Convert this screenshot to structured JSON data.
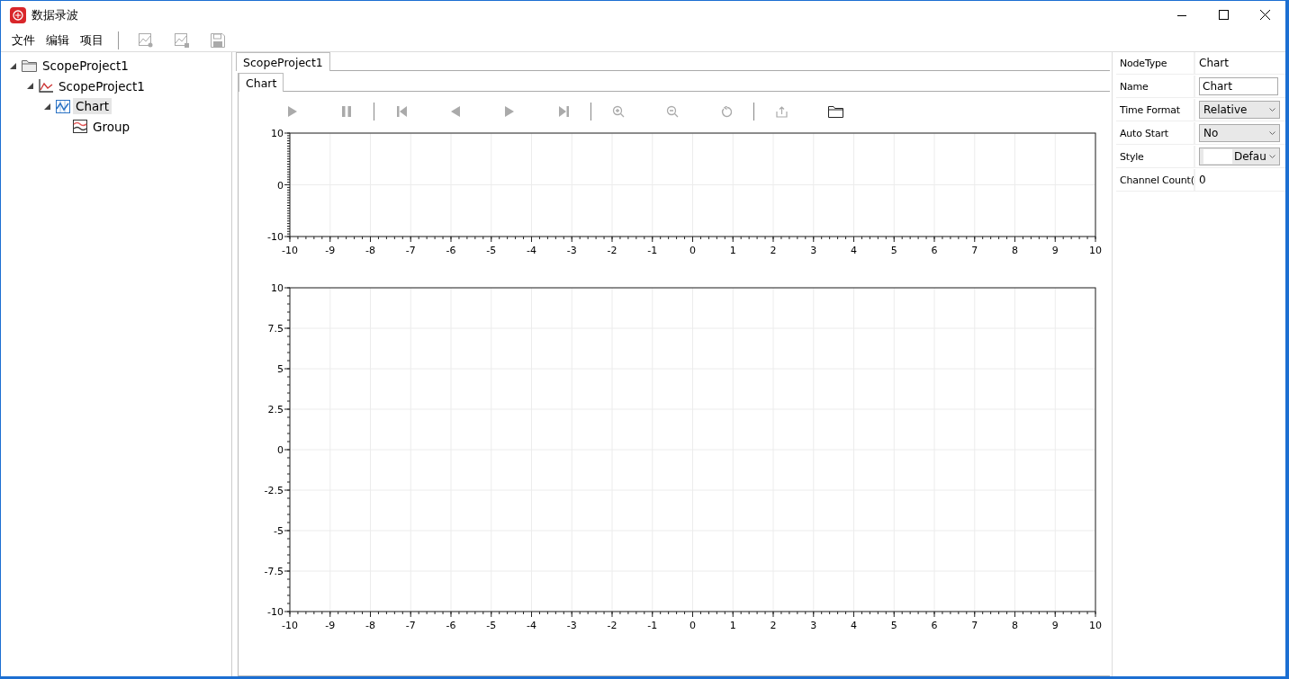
{
  "window": {
    "title": "数据录波"
  },
  "menu": [
    "文件",
    "编辑",
    "项目"
  ],
  "menu_toolbar": [
    {
      "kind": "add-chart",
      "disabled": true
    },
    {
      "kind": "add-group",
      "disabled": true
    },
    {
      "kind": "save",
      "disabled": true
    }
  ],
  "tree": [
    {
      "label": "ScopeProject1",
      "kind": "folder",
      "expanded": true,
      "selected": false,
      "children": [
        {
          "label": "ScopeProject1",
          "kind": "scope",
          "expanded": true,
          "selected": false,
          "children": [
            {
              "label": "Chart",
              "kind": "chart",
              "expanded": true,
              "selected": true,
              "children": [
                {
                  "label": "Group",
                  "kind": "group",
                  "selected": false
                }
              ]
            }
          ]
        }
      ]
    }
  ],
  "document_tabs": [
    {
      "label": "ScopeProject1",
      "selected": true
    }
  ],
  "chart_tabs": [
    {
      "label": "Chart",
      "selected": true
    }
  ],
  "chart_toolbar": [
    {
      "kind": "play",
      "disabled": true
    },
    {
      "kind": "pause",
      "disabled": true
    },
    {
      "kind": "separator"
    },
    {
      "kind": "first",
      "disabled": true
    },
    {
      "kind": "prev",
      "disabled": true
    },
    {
      "kind": "next",
      "disabled": true
    },
    {
      "kind": "last",
      "disabled": true
    },
    {
      "kind": "separator"
    },
    {
      "kind": "zoom-in",
      "disabled": true
    },
    {
      "kind": "zoom-out",
      "disabled": true
    },
    {
      "kind": "reset",
      "disabled": true
    },
    {
      "kind": "separator"
    },
    {
      "kind": "export",
      "disabled": true
    },
    {
      "kind": "open",
      "disabled": false
    }
  ],
  "charts": [
    {
      "chart_data": {
        "type": "line",
        "xlim": [
          -10,
          10
        ],
        "ylim": [
          -10,
          10
        ],
        "xticks": [
          -10,
          -9,
          -8,
          -7,
          -6,
          -5,
          -4,
          -3,
          -2,
          -1,
          0,
          1,
          2,
          3,
          4,
          5,
          6,
          7,
          8,
          9,
          10
        ],
        "yticks": [
          -10,
          0,
          10
        ],
        "grid": true
      }
    },
    {
      "chart_data": {
        "type": "line",
        "xlim": [
          -10,
          10
        ],
        "ylim": [
          -10,
          10
        ],
        "xticks": [
          -10,
          -9,
          -8,
          -7,
          -6,
          -5,
          -4,
          -3,
          -2,
          -1,
          0,
          1,
          2,
          3,
          4,
          5,
          6,
          7,
          8,
          9,
          10
        ],
        "yticks": [
          -10,
          -7.5,
          -5,
          -2.5,
          0,
          2.5,
          5,
          7.5,
          10
        ],
        "grid": true
      }
    }
  ],
  "properties": [
    {
      "label": "NodeType",
      "value": "Chart",
      "kind": "text"
    },
    {
      "label": "Name",
      "value": "Chart",
      "kind": "input"
    },
    {
      "label": "Time Format",
      "value": "Relative",
      "kind": "dropdown"
    },
    {
      "label": "Auto Start",
      "value": "No",
      "kind": "dropdown"
    },
    {
      "label": "Style",
      "value": "Defau",
      "kind": "swatch-dropdown"
    },
    {
      "label": "Channel Count(",
      "value": "0",
      "kind": "text"
    }
  ]
}
